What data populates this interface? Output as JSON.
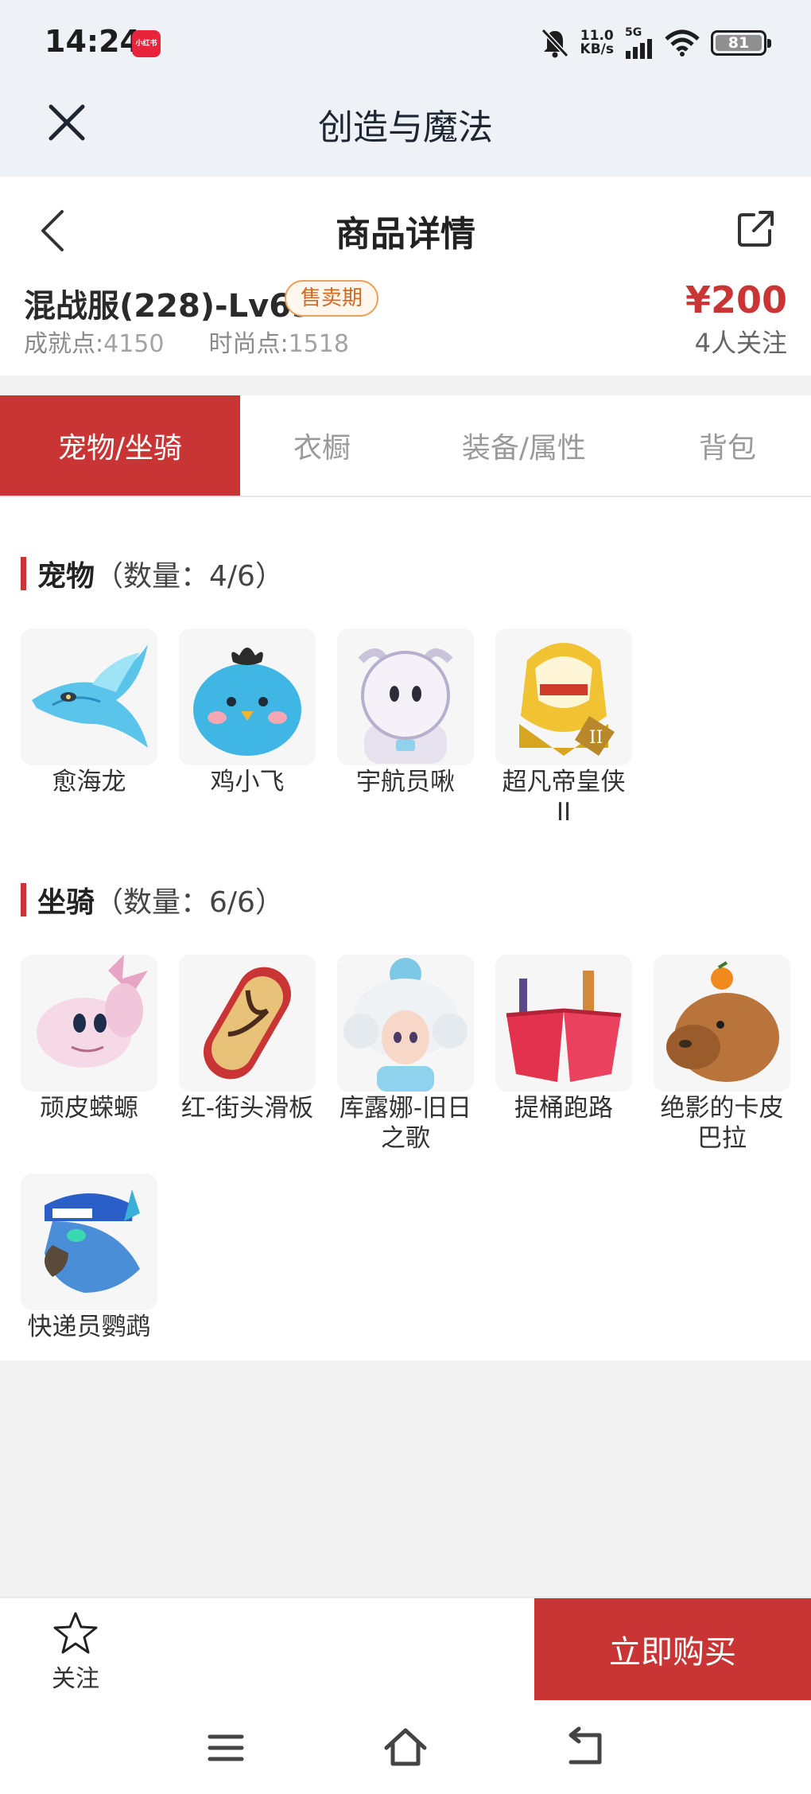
{
  "status_bar": {
    "time": "14:24",
    "app_badge": "小红书",
    "net_speed_value": "11.0",
    "net_speed_unit": "KB/s",
    "network": "5G",
    "battery": "81"
  },
  "app_bar": {
    "title": "创造与魔法"
  },
  "product": {
    "page_title": "商品详情",
    "name": "混战服(228)-Lv69",
    "status_badge": "售卖期",
    "achievement_label": "成就点:",
    "achievement_value": "4150",
    "fashion_label": "时尚点:",
    "fashion_value": "1518",
    "price": "¥200",
    "followers": "4人关注"
  },
  "tabs": [
    {
      "label": "宠物/坐骑",
      "active": true
    },
    {
      "label": "衣橱",
      "active": false
    },
    {
      "label": "装备/属性",
      "active": false
    },
    {
      "label": "背包",
      "active": false
    }
  ],
  "sections": {
    "pets": {
      "title": "宠物",
      "count": "（数量：4/6）",
      "items": [
        {
          "name": "愈海龙",
          "icon": "blue-dragon-icon"
        },
        {
          "name": "鸡小飞",
          "icon": "blue-chick-icon"
        },
        {
          "name": "宇航员啾",
          "icon": "astronaut-creature-icon"
        },
        {
          "name": "超凡帝皇侠II",
          "icon": "golden-warrior-icon"
        }
      ]
    },
    "mounts": {
      "title": "坐骑",
      "count": "（数量：6/6）",
      "items": [
        {
          "name": "顽皮蝾螈",
          "icon": "axolotl-icon"
        },
        {
          "name": "红-街头滑板",
          "icon": "skateboard-icon"
        },
        {
          "name": "库露娜-旧日之歌",
          "icon": "cloud-girl-icon"
        },
        {
          "name": "提桶跑路",
          "icon": "buckets-icon"
        },
        {
          "name": "绝影的卡皮巴拉",
          "icon": "capybara-icon"
        },
        {
          "name": "快递员鹦鹉",
          "icon": "courier-parrot-icon"
        }
      ]
    }
  },
  "bottom_bar": {
    "follow_label": "关注",
    "buy_label": "立即购买"
  },
  "colors": {
    "accent": "#c93434",
    "badge_orange": "#d4691c",
    "top_bg": "#eef2f6"
  }
}
